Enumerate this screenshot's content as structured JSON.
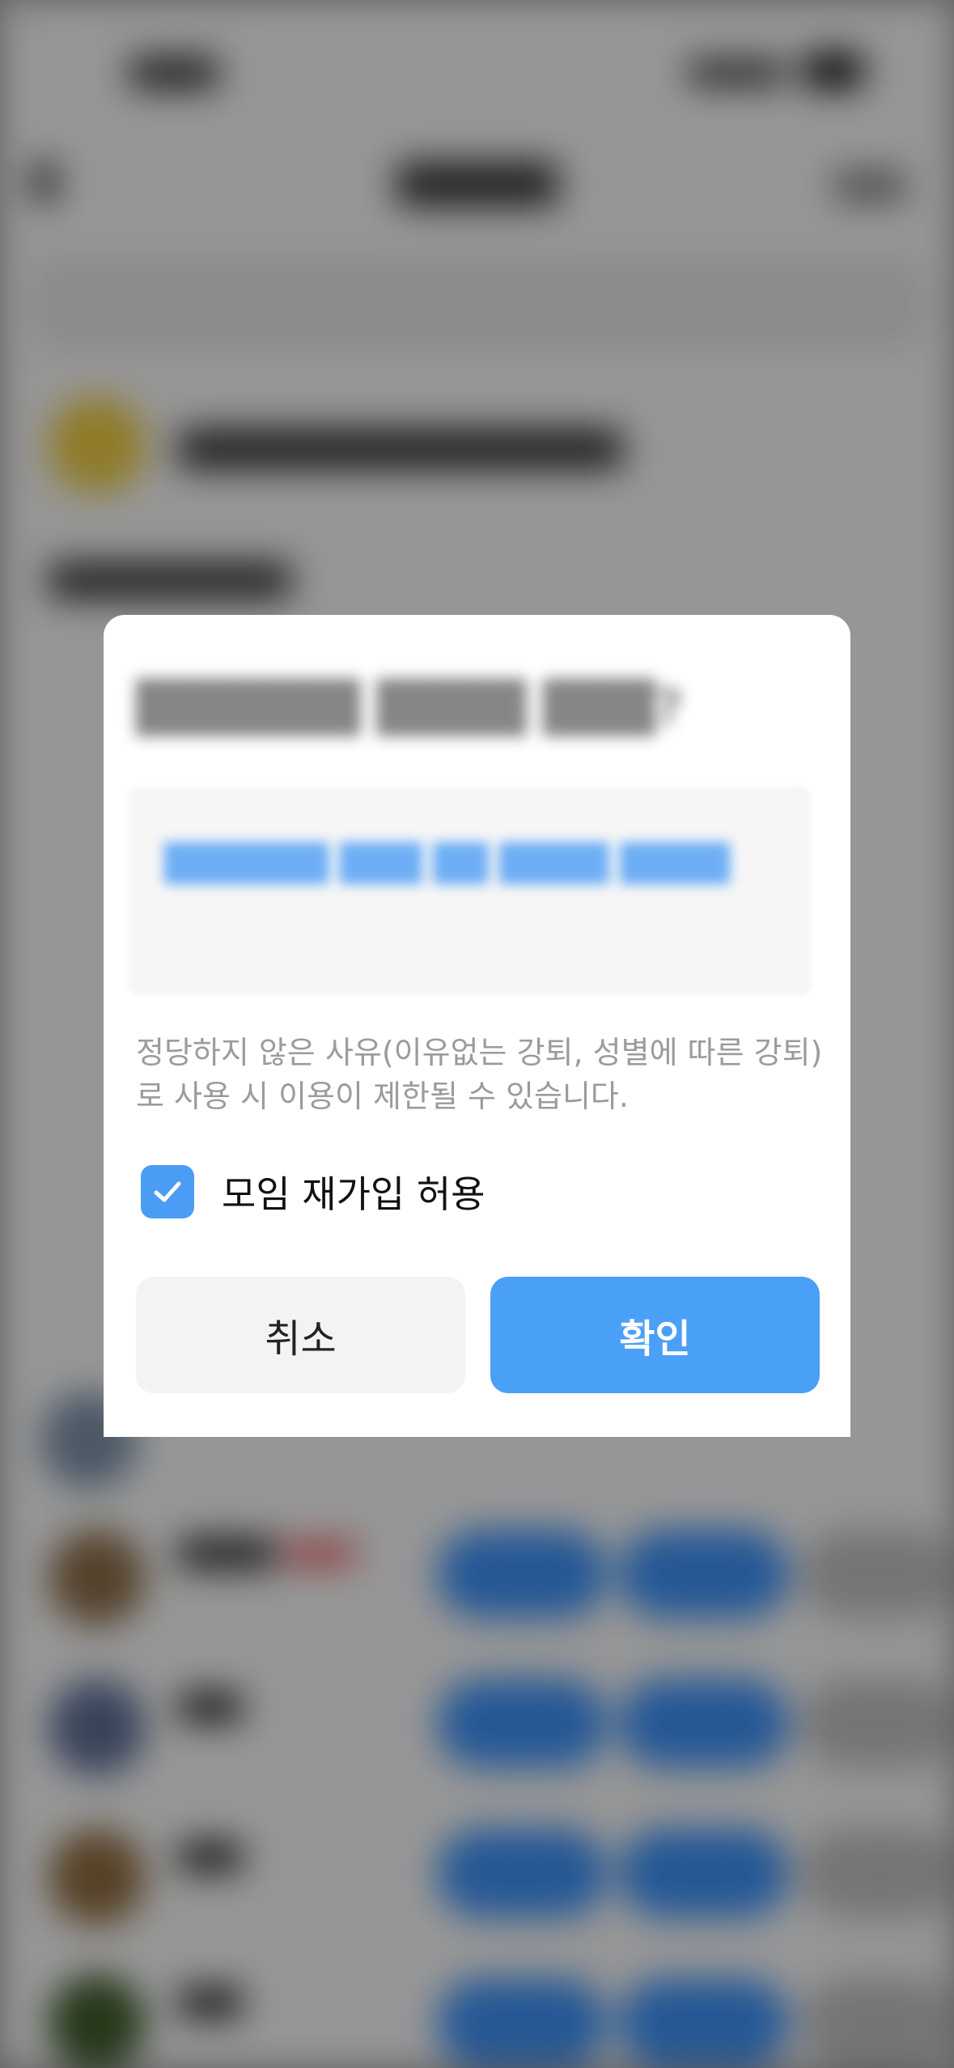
{
  "dialog": {
    "notice": "정당하지 않은 사유(이유없는 강퇴, 성별에 따른 강퇴)로 사용 시 이용이 제한될 수 있습니다.",
    "rejoin_checkbox": {
      "label": "모임 재가입 허용",
      "checked": true
    },
    "cancel_label": "취소",
    "confirm_label": "확인"
  },
  "colors": {
    "accent": "#4a9ff7",
    "checkbox": "#4a9cf5",
    "notice_text": "#9b9b9b",
    "cancel_bg": "#f3f3f3"
  },
  "icons": {
    "checkbox": "checkmark-icon"
  }
}
